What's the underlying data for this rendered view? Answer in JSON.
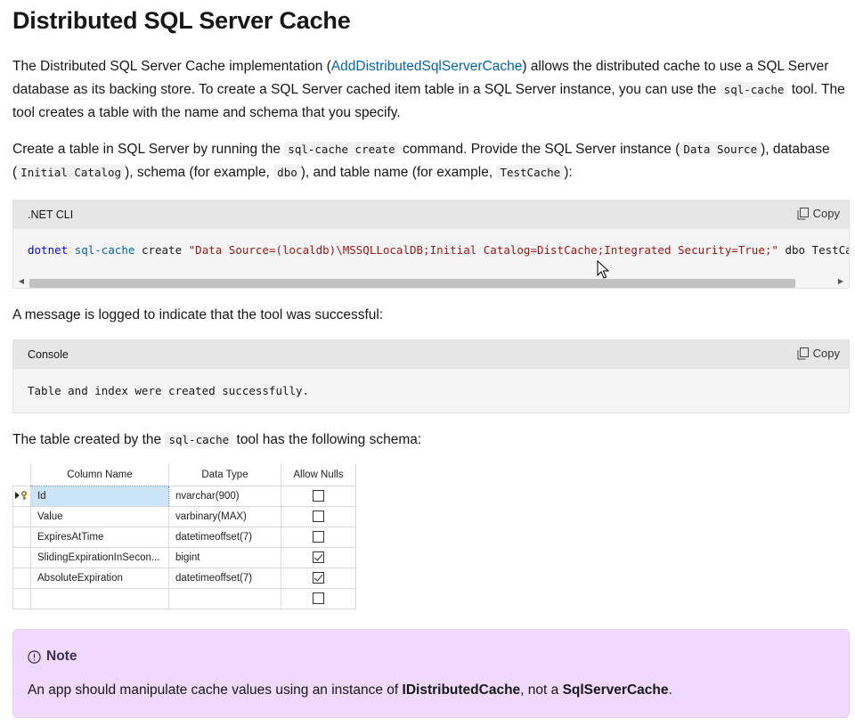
{
  "heading": "Distributed SQL Server Cache",
  "intro": {
    "t1": "The Distributed SQL Server Cache implementation (",
    "link": "AddDistributedSqlServerCache",
    "t2": ") allows the distributed cache to use a SQL Server database as its backing store. To create a SQL Server cached item table in a SQL Server instance, you can use the ",
    "code": "sql-cache",
    "t3": " tool. The tool creates a table with the name and schema that you specify."
  },
  "create_para": {
    "t1": "Create a table in SQL Server by running the ",
    "c1": "sql-cache create",
    "t2": " command. Provide the SQL Server instance (",
    "c2": "Data Source",
    "t3": "), database (",
    "c3": "Initial Catalog",
    "t4": "), schema (for example, ",
    "c4": "dbo",
    "t5": "), and table name (for example, ",
    "c5": "TestCache",
    "t6": "):"
  },
  "cli_block": {
    "lang": ".NET CLI",
    "copy_label": "Copy",
    "kw": "dotnet",
    "cmd": "sql-cache",
    "verb": "create",
    "str": "\"Data Source=(localdb)\\MSSQLLocalDB;Initial Catalog=DistCache;Integrated Security=True;\"",
    "tail": "dbo TestCache"
  },
  "message_para": "A message is logged to indicate that the tool was successful:",
  "console_block": {
    "lang": "Console",
    "copy_label": "Copy",
    "code": "Table and index were created successfully."
  },
  "schema_para": {
    "t1": "The table created by the ",
    "code": "sql-cache",
    "t2": " tool has the following schema:"
  },
  "schema_table": {
    "headers": [
      "Column Name",
      "Data Type",
      "Allow Nulls"
    ],
    "rows": [
      {
        "name": "Id",
        "type": "nvarchar(900)",
        "nulls": false
      },
      {
        "name": "Value",
        "type": "varbinary(MAX)",
        "nulls": false
      },
      {
        "name": "ExpiresAtTime",
        "type": "datetimeoffset(7)",
        "nulls": false
      },
      {
        "name": "SlidingExpirationInSecon...",
        "type": "bigint",
        "nulls": true
      },
      {
        "name": "AbsoluteExpiration",
        "type": "datetimeoffset(7)",
        "nulls": true
      },
      {
        "name": "",
        "type": "",
        "nulls": false
      }
    ]
  },
  "note": {
    "title": "Note",
    "t1": "An app should manipulate cache values using an instance of ",
    "b1": "IDistributedCache",
    "t2": ", not a ",
    "b2": "SqlServerCache",
    "t3": "."
  },
  "colors": {
    "link": "#0065b3",
    "note_bg": "#f0d9fd",
    "code_keyword": "#0101fd",
    "code_string": "#a31515"
  }
}
